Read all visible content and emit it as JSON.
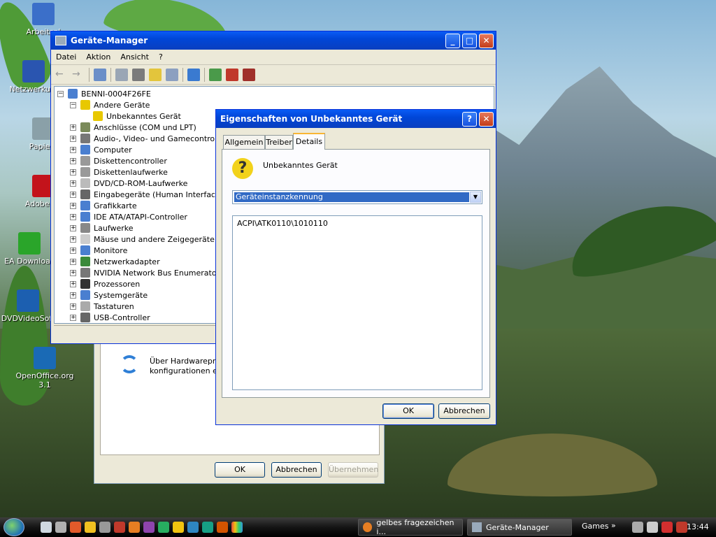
{
  "desktop": {
    "icons": [
      {
        "label": "Arbeitspl",
        "color": "#3b6fc9"
      },
      {
        "label": "Netzwerkum",
        "color": "#2a55b0"
      },
      {
        "label": "Papierk",
        "color": "#8aa0a8"
      },
      {
        "label": "Adobe Re",
        "color": "#c3131b"
      },
      {
        "label": "EA Downloac",
        "color": "#2aa52a"
      },
      {
        "label": "DVDVideoSoft",
        "color": "#1c5fb0"
      },
      {
        "label": "OpenOffice.org 3.1",
        "color": "#1a6ab5"
      }
    ]
  },
  "device_manager": {
    "title": "Geräte-Manager",
    "menu": [
      "Datei",
      "Aktion",
      "Ansicht",
      "?"
    ],
    "tree": {
      "root": "BENNI-0004F26FE",
      "items": [
        {
          "label": "Andere Geräte",
          "expanded": true,
          "icon": "#e8c800"
        },
        {
          "label": "Unbekanntes Gerät",
          "child": true,
          "icon": "#e8c800"
        },
        {
          "label": "Anschlüsse (COM und LPT)",
          "icon": "#7a8a5a"
        },
        {
          "label": "Audio-, Video- und Gamecontroller",
          "icon": "#777777"
        },
        {
          "label": "Computer",
          "icon": "#4a7fd0"
        },
        {
          "label": "Diskettencontroller",
          "icon": "#999999"
        },
        {
          "label": "Diskettenlaufwerke",
          "icon": "#999999"
        },
        {
          "label": "DVD/CD-ROM-Laufwerke",
          "icon": "#bbbbbb"
        },
        {
          "label": "Eingabegeräte (Human Interface De",
          "icon": "#666666"
        },
        {
          "label": "Grafikkarte",
          "icon": "#4a7fd0"
        },
        {
          "label": "IDE ATA/ATAPI-Controller",
          "icon": "#4a7fd0"
        },
        {
          "label": "Laufwerke",
          "icon": "#888888"
        },
        {
          "label": "Mäuse und andere Zeigegeräte",
          "icon": "#cccccc"
        },
        {
          "label": "Monitore",
          "icon": "#4a7fd0"
        },
        {
          "label": "Netzwerkadapter",
          "icon": "#3a8a3a"
        },
        {
          "label": "NVIDIA Network Bus Enumerator",
          "icon": "#777777"
        },
        {
          "label": "Prozessoren",
          "icon": "#333333"
        },
        {
          "label": "Systemgeräte",
          "icon": "#4a7fd0"
        },
        {
          "label": "Tastaturen",
          "icon": "#aaaaaa"
        },
        {
          "label": "USB-Controller",
          "icon": "#666666"
        }
      ]
    }
  },
  "system_props": {
    "text_line1": "Über Hardwareprofi",
    "text_line2": "konfigurationen einr",
    "ok": "OK",
    "cancel": "Abbrechen",
    "apply": "Übernehmen"
  },
  "props_dialog": {
    "title": "Eigenschaften von Unbekanntes Gerät",
    "help": "?",
    "tabs": [
      "Allgemein",
      "Treiber",
      "Details"
    ],
    "active_tab": "Details",
    "device_name": "Unbekanntes Gerät",
    "property_selected": "Geräteinstanzkennung",
    "value": "ACPI\\ATK0110\\1010110",
    "ok": "OK",
    "cancel": "Abbrechen"
  },
  "taskbar": {
    "tasks": [
      "gelbes fragezeichen i...",
      "Geräte-Manager"
    ],
    "games": "Games",
    "clock": "13:44"
  }
}
